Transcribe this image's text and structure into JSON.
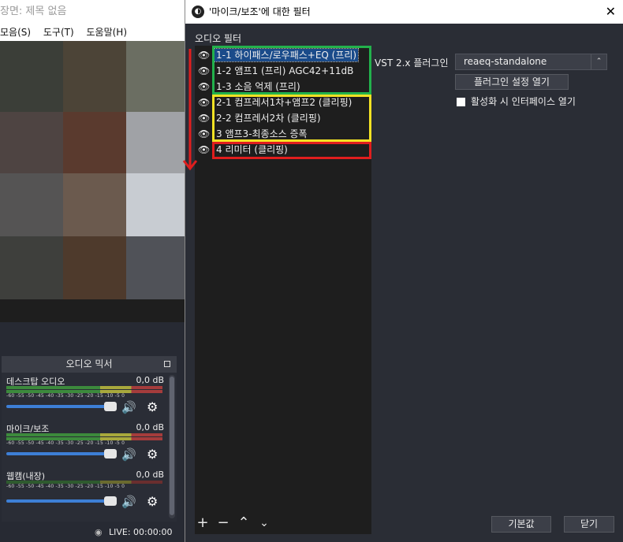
{
  "main": {
    "title": "장면: 제목 없음",
    "menu": [
      "모음(S)",
      "도구(T)",
      "도움말(H)"
    ]
  },
  "mixer": {
    "title": "오디오 믹서",
    "scale": "-60  -55  -50  -45  -40  -35  -30  -25  -20  -15  -10  -5   0",
    "channels": [
      {
        "name": "데스크탑 오디오",
        "db": "0,0 dB"
      },
      {
        "name": "마이크/보조",
        "db": "0,0 dB"
      },
      {
        "name": "웹캠(내장)",
        "db": "0,0 dB"
      }
    ]
  },
  "status": {
    "live": "LIVE: 00:00:00"
  },
  "dialog": {
    "title": "'마이크/보조'에 대한 필터",
    "section_label": "오디오 필터",
    "filters": [
      "1-1 하이패스/로우패스+EQ (프리)",
      "1-2 앰프1 (프리) AGC42+11dB",
      "1-3 소음 억제 (프리)",
      "2-1 컴프레서1차+앰프2 (클리핑)",
      "2-2 컴프레서2차 (클리핑)",
      "3 앰프3-최종소스 증폭",
      "4 리미터 (클리핑)"
    ],
    "plugin_label": "VST 2.x 플러그인",
    "plugin_value": "reaeq-standalone",
    "open_button": "플러그인 설정 열기",
    "checkbox_label": "활성화 시 인터페이스 열기",
    "default_button": "기본값",
    "close_button": "닫기"
  },
  "annotation_colors": {
    "group1": "#22b14c",
    "group2": "#f2e224",
    "group3": "#e01e1e",
    "arrow": "#e01e1e"
  }
}
